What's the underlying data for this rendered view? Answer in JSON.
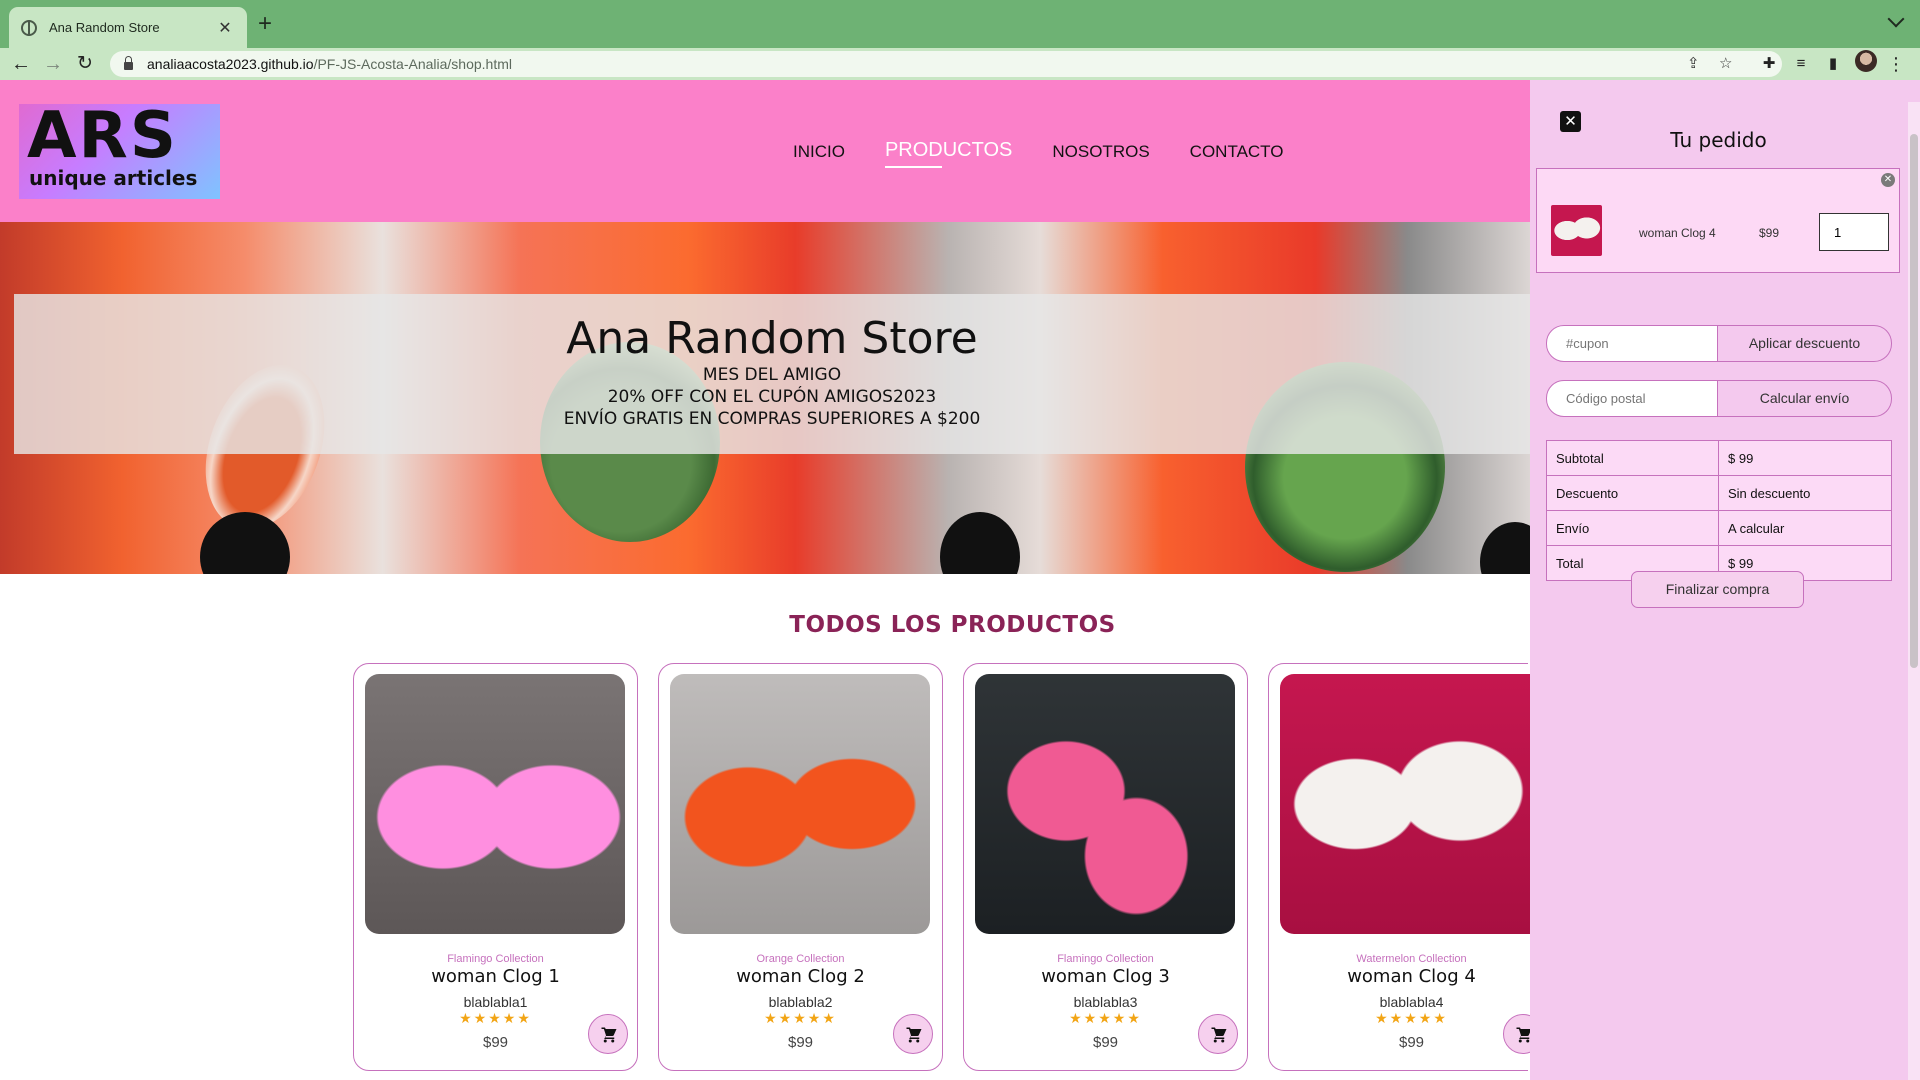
{
  "browser": {
    "tab_title": "Ana Random Store",
    "tab_close": "✕",
    "new_tab": "+",
    "url_host": "analiaacosta2023.github.io",
    "url_path": "/PF-JS-Acosta-Analia/shop.html"
  },
  "site": {
    "logo_big": "ARS",
    "logo_small": "unique articles",
    "nav": [
      {
        "label": "INICIO",
        "active": false
      },
      {
        "label": "PRODUCTOS",
        "active": true
      },
      {
        "label": "NOSOTROS",
        "active": false
      },
      {
        "label": "CONTACTO",
        "active": false
      }
    ],
    "hero": {
      "title": "Ana Random Store",
      "line1": "MES DEL AMIGO",
      "line2": "20% OFF CON EL CUPÓN AMIGOS2023",
      "line3": "ENVÍO GRATIS EN COMPRAS SUPERIORES A $200"
    },
    "section_title": "TODOS LOS PRODUCTOS"
  },
  "products": [
    {
      "collection": "Flamingo Collection",
      "name": "woman Clog 1",
      "desc": "blablabla1",
      "stars": "★★★★★",
      "price": "$99",
      "image": "pink-flamingo-clogs",
      "color": "#f26ccf"
    },
    {
      "collection": "Orange Collection",
      "name": "woman Clog 2",
      "desc": "blablabla2",
      "stars": "★★★★★",
      "price": "$99",
      "image": "orange-fruit-clogs",
      "color": "#f2541e"
    },
    {
      "collection": "Flamingo Collection",
      "name": "woman Clog 3",
      "desc": "blablabla3",
      "stars": "★★★★★",
      "price": "$99",
      "image": "pink-watermelon-clogs",
      "color": "#f05a93"
    },
    {
      "collection": "Watermelon Collection",
      "name": "woman Clog 4",
      "desc": "blablabla4",
      "stars": "★★★★★",
      "price": "$99",
      "image": "white-watermelon-slides",
      "color": "#c5174f"
    }
  ],
  "cart": {
    "title": "Tu pedido",
    "close": "✕",
    "item": {
      "name": "woman Clog 4",
      "price": "$99",
      "qty": "1"
    },
    "coupon_placeholder": "#cupon",
    "coupon_button": "Aplicar descuento",
    "zip_placeholder": "Código postal",
    "zip_button": "Calcular envío",
    "totals": {
      "subtotal_label": "Subtotal",
      "subtotal_value": "$ 99",
      "discount_label": "Descuento",
      "discount_value": "Sin descuento",
      "shipping_label": "Envío",
      "shipping_value": "A calcular",
      "total_label": "Total",
      "total_value": "$ 99"
    },
    "checkout_button": "Finalizar compra"
  },
  "colors": {
    "header": "#fb80c9",
    "accent": "#c671bd",
    "title": "#8a2357",
    "stars": "#f2a516",
    "cart_bg": "#f4c9ee"
  }
}
